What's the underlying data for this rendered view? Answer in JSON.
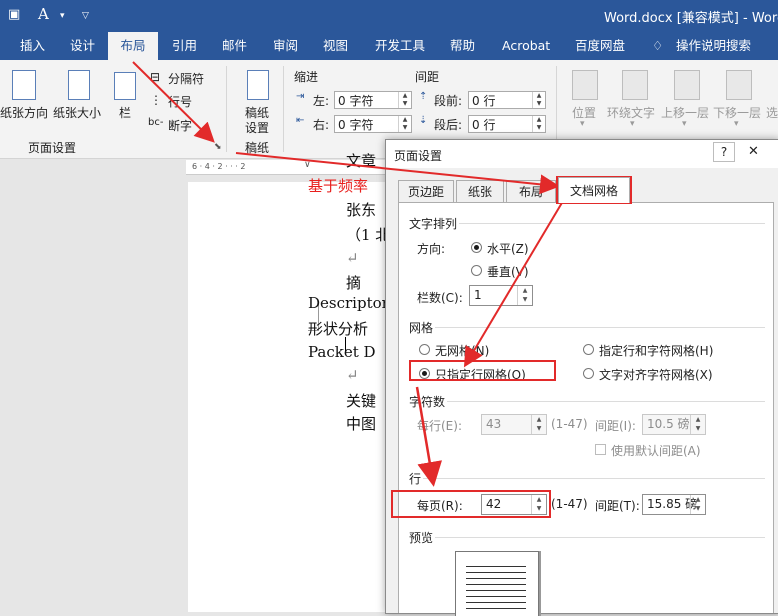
{
  "window": {
    "title": "Word.docx [兼容模式]  -  Word",
    "font_glyph": "A"
  },
  "tabs": [
    "插入",
    "设计",
    "布局",
    "引用",
    "邮件",
    "审阅",
    "视图",
    "开发工具",
    "帮助",
    "Acrobat",
    "百度网盘",
    "操作说明搜索"
  ],
  "active_tab": "布局",
  "ribbon": {
    "page_setup": {
      "orientation": "纸张方向",
      "size": "纸张大小",
      "columns": "栏",
      "breaks": "分隔符",
      "line_numbers": "行号",
      "hyphenation": "断字",
      "group_label": "页面设置"
    },
    "manuscript": {
      "button": "稿纸设置",
      "button_line1": "稿纸",
      "button_line2": "设置",
      "group_label": "稿纸"
    },
    "paragraph": {
      "indent_header": "缩进",
      "spacing_header": "间距",
      "left_label": "左:",
      "left_value": "0 字符",
      "right_label": "右:",
      "right_value": "0 字符",
      "before_label": "段前:",
      "before_value": "0 行",
      "after_label": "段后:",
      "after_value": "0 行"
    },
    "arrange": {
      "position": "位置",
      "wrap_text": "环绕文字",
      "bring_forward": "上移一层",
      "send_backward": "下移一层",
      "select": "选"
    }
  },
  "document": {
    "lines": [
      {
        "text": "文章",
        "color": "#111111"
      },
      {
        "text": "基于频率",
        "color": "#e8201e"
      },
      {
        "text": "张东",
        "color": "#111111"
      },
      {
        "text": "（1 北",
        "color": "#111111"
      },
      {
        "text": "↵",
        "color": "#888888"
      },
      {
        "text": "摘",
        "color": "#111111"
      },
      {
        "text": "Descriptor",
        "color": "#111111"
      },
      {
        "text": "形状分析",
        "color": "#111111"
      },
      {
        "text": "Packet  D",
        "color": "#111111"
      },
      {
        "text": "↵",
        "color": "#888888"
      },
      {
        "text": "关键",
        "color": "#111111"
      },
      {
        "text": "中图",
        "color": "#111111"
      }
    ]
  },
  "dialog": {
    "title": "页面设置",
    "help": "?",
    "close": "✕",
    "tabs": [
      "页边距",
      "纸张",
      "布局",
      "文档网格"
    ],
    "active_tab": "文档网格",
    "text_flow": {
      "header": "文字排列",
      "direction_label": "方向:",
      "horizontal": "水平(Z)",
      "vertical": "垂直(V)",
      "columns_label": "栏数(C):",
      "columns_value": "1"
    },
    "grid": {
      "header": "网格",
      "no_grid": "无网格(N)",
      "lines_only": "只指定行网格(O)",
      "lines_and_chars": "指定行和字符网格(H)",
      "snap_chars": "文字对齐字符网格(X)",
      "selected": "只指定行网格(O)"
    },
    "characters": {
      "header": "字符数",
      "per_line_label": "每行(E):",
      "per_line_value": "43",
      "per_line_range": "(1-47)",
      "pitch_label": "间距(I):",
      "pitch_value": "10.5 磅",
      "default_pitch": "使用默认间距(A)"
    },
    "lines": {
      "header": "行",
      "per_page_label": "每页(R):",
      "per_page_value": "42",
      "per_page_range": "(1-47)",
      "pitch_label": "间距(T):",
      "pitch_value": "15.85 磅"
    },
    "preview": {
      "header": "预览"
    }
  },
  "colors": {
    "word_blue": "#2b579a",
    "highlight_red": "#e22a2a"
  }
}
